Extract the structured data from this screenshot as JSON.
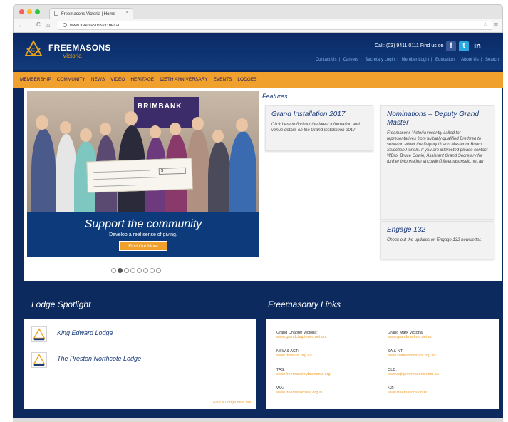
{
  "browser": {
    "tab_title": "Freemasons Victoria | Home",
    "tab_close": "×",
    "url": "www.freemasonsvic.net.au",
    "back": "←",
    "forward": "→",
    "reload": "C",
    "home": "⌂",
    "menu": "≡",
    "bookmark": "☆"
  },
  "header": {
    "logo_name": "FREEMASONS",
    "logo_sub": "Victoria",
    "call": "Call: (03) 9411 0111  Find us on",
    "top_links": [
      "Contact Us",
      "Careers",
      "Secretary Login",
      "Member Login",
      "Education",
      "About Us",
      "Search"
    ]
  },
  "nav": [
    "MEMBERSHIP",
    "COMMUNITY",
    "NEWS",
    "VIDEO",
    "HERITAGE",
    "125TH ANNIVERSARY",
    "EVENTS",
    "LODGES"
  ],
  "slider": {
    "banner": "BRIMBANK",
    "cheque_amount": "$",
    "title": "Support the community",
    "subtitle": "Develop a real sense of giving.",
    "button": "Find Out More",
    "dot_count": 8,
    "active_dot": 1
  },
  "features": {
    "title": "Features",
    "cards": [
      {
        "title": "Grand Installation 2017",
        "body": "Click here to find out the latest information and venue details on the Grand Installation 2017"
      },
      {
        "title": "Nominations – Deputy Grand Master",
        "body": "Freemasons Victoria recently called for representatives from suitably qualified Brethren to serve on either the Deputy Grand Master or Board Selection Panels. If you are interested please contact WBro. Bruce Cowie, Assistant Grand Secretary for further information at cowie@freemasonsvic.net.au"
      },
      {
        "title": "Engage 132",
        "body": "Check out the updates on Engage 132 newsletter."
      }
    ]
  },
  "lodge_spotlight": {
    "title": "Lodge Spotlight",
    "items": [
      "King Edward Lodge",
      "The Preston Northcote Lodge"
    ],
    "link": "Find a Lodge near you"
  },
  "freemasonry_links": {
    "title": "Freemasonry Links",
    "items": [
      {
        "name": "Grand Chapter Victoria:",
        "url": "www.grandchaptervic.net.au"
      },
      {
        "name": "Grand Mark Victoria:",
        "url": "www.grandmarkvic.net.au"
      },
      {
        "name": "NSW & ACT:",
        "url": "www.masons.org.au"
      },
      {
        "name": "SA & NT:",
        "url": "www.saltfreemasons.org.au"
      },
      {
        "name": "TAS:",
        "url": "www.freemasonrytasmania.org"
      },
      {
        "name": "QLD:",
        "url": "www.uglqfreemasons.com.au"
      },
      {
        "name": "WA:",
        "url": "www.freemasonswa.org.au"
      },
      {
        "name": "NZ:",
        "url": "www.freemasons.co.nz"
      }
    ]
  },
  "colors": {
    "navy": "#0c2a5e",
    "orange": "#f0a12d",
    "heading": "#1a3a7a"
  }
}
